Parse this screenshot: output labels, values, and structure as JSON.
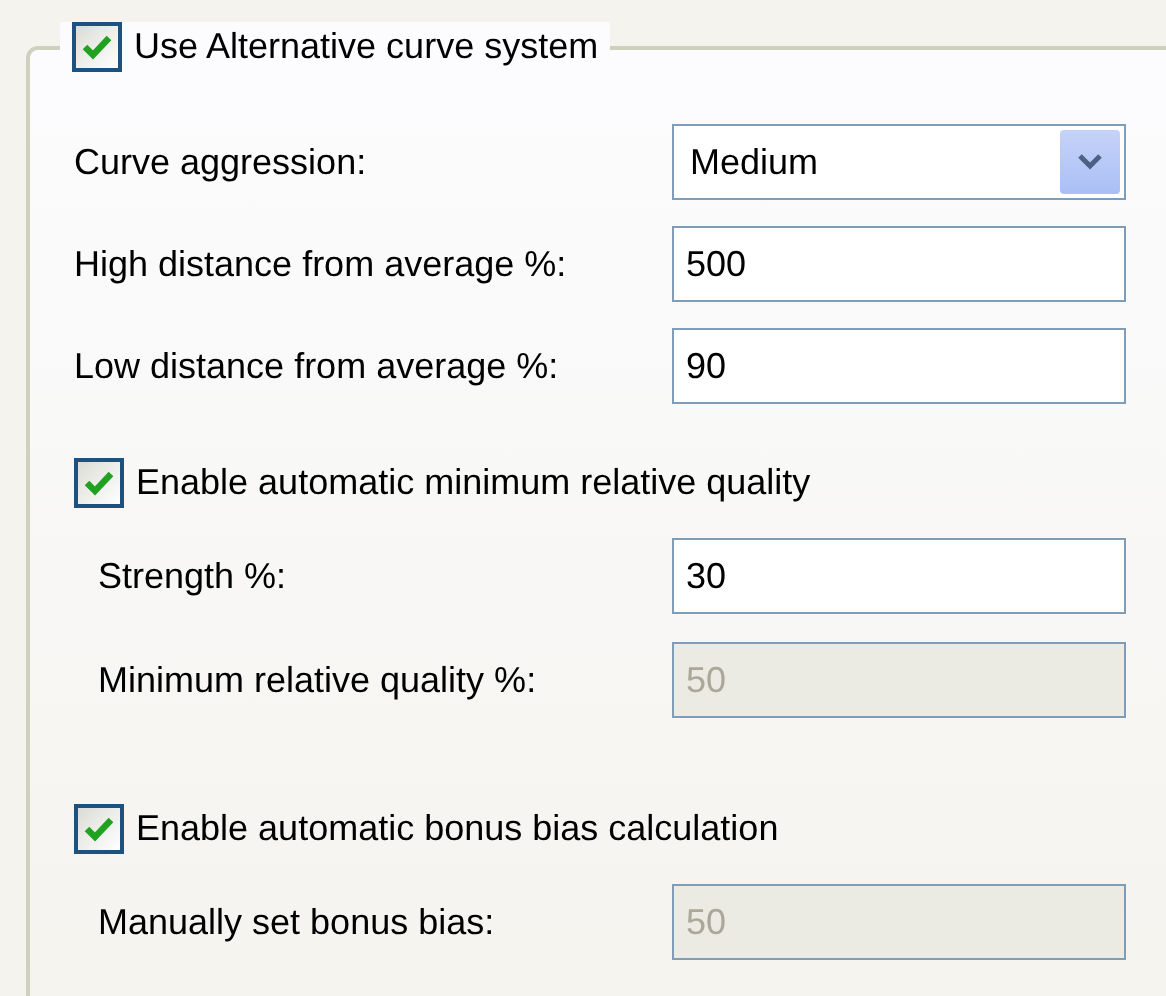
{
  "group": {
    "label": "Use Alternative curve system",
    "checked": true
  },
  "rows": [
    {
      "kind": "select",
      "label": "Curve aggression:",
      "value": "Medium"
    },
    {
      "kind": "text",
      "label": "High distance from average %:",
      "value": "500",
      "disabled": false
    },
    {
      "kind": "text",
      "label": "Low distance from average %:",
      "value": "90",
      "disabled": false
    }
  ],
  "sections": [
    {
      "label": "Enable automatic minimum relative quality",
      "checked": true,
      "fields": [
        {
          "kind": "text",
          "label": "Strength %:",
          "value": "30",
          "disabled": false
        },
        {
          "kind": "text",
          "label": "Minimum relative quality %:",
          "value": "50",
          "disabled": true
        }
      ]
    },
    {
      "label": "Enable automatic bonus bias calculation",
      "checked": true,
      "fields": [
        {
          "kind": "text",
          "label": "Manually set bonus bias:",
          "value": "50",
          "disabled": true
        }
      ]
    }
  ]
}
